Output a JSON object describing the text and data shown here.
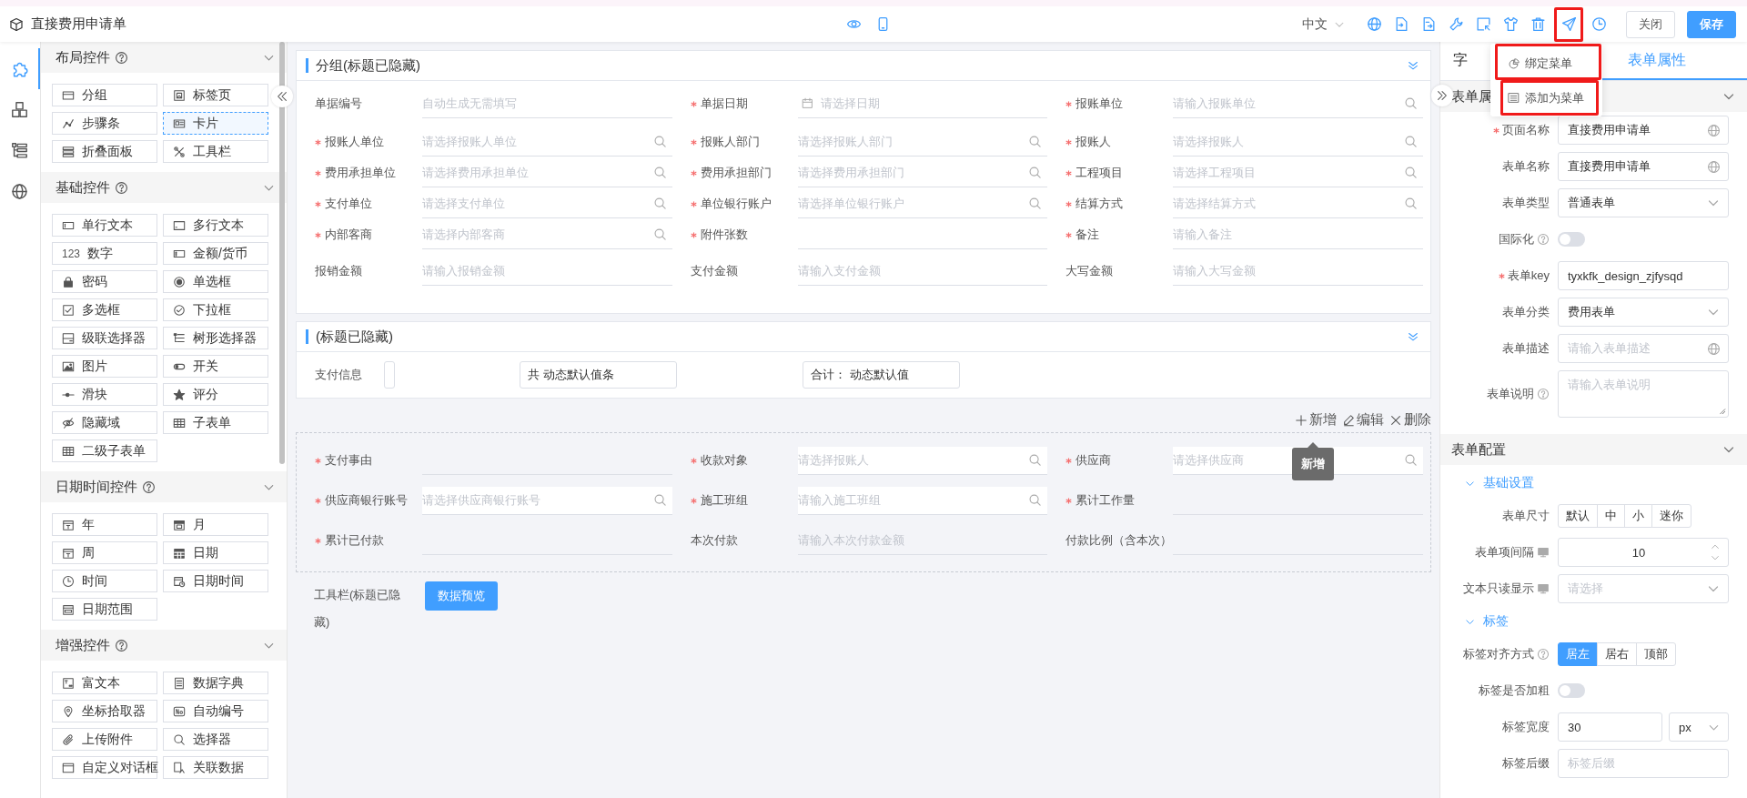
{
  "topbar": {
    "title": "直接费用申请单",
    "language": "中文",
    "buttons": [
      {
        "label": "关闭",
        "kind": "default"
      },
      {
        "label": "保存",
        "kind": "primary"
      }
    ]
  },
  "rail": [
    {
      "selected": true
    },
    {
      "selected": false
    },
    {
      "selected": false
    },
    {
      "selected": false
    }
  ],
  "palette": {
    "sections": [
      {
        "title": "布局控件",
        "items": [
          {
            "label": "分组",
            "selected": false
          },
          {
            "label": "标签页",
            "selected": false
          },
          {
            "label": "步骤条",
            "selected": false
          },
          {
            "label": "卡片",
            "selected": true
          },
          {
            "label": "折叠面板",
            "selected": false
          },
          {
            "label": "工具栏",
            "selected": false
          }
        ]
      },
      {
        "title": "基础控件",
        "items": [
          {
            "label": "单行文本",
            "selected": false
          },
          {
            "label": "多行文本",
            "selected": false
          },
          {
            "label": "数字",
            "glyph": "123",
            "selected": false
          },
          {
            "label": "金额/货币",
            "selected": false
          },
          {
            "label": "密码",
            "selected": false
          },
          {
            "label": "单选框",
            "selected": false
          },
          {
            "label": "多选框",
            "selected": false
          },
          {
            "label": "下拉框",
            "selected": false
          },
          {
            "label": "级联选择器",
            "selected": false
          },
          {
            "label": "树形选择器",
            "selected": false
          },
          {
            "label": "图片",
            "selected": false
          },
          {
            "label": "开关",
            "selected": false
          },
          {
            "label": "滑块",
            "selected": false
          },
          {
            "label": "评分",
            "selected": false
          },
          {
            "label": "隐藏域",
            "selected": false
          },
          {
            "label": "子表单",
            "selected": false
          },
          {
            "label": "二级子表单",
            "selected": false
          }
        ]
      },
      {
        "title": "日期时间控件",
        "items": [
          {
            "label": "年",
            "selected": false
          },
          {
            "label": "月",
            "selected": false
          },
          {
            "label": "周",
            "selected": false
          },
          {
            "label": "日期",
            "selected": false
          },
          {
            "label": "时间",
            "selected": false
          },
          {
            "label": "日期时间",
            "selected": false
          },
          {
            "label": "日期范围",
            "selected": false
          }
        ]
      },
      {
        "title": "增强控件",
        "items": [
          {
            "label": "富文本",
            "selected": false
          },
          {
            "label": "数据字典",
            "selected": false
          },
          {
            "label": "坐标拾取器",
            "selected": false
          },
          {
            "label": "自动编号",
            "selected": false
          },
          {
            "label": "上传附件",
            "selected": false
          },
          {
            "label": "选择器",
            "selected": false
          },
          {
            "label": "自定义对话框",
            "selected": false
          },
          {
            "label": "关联数据",
            "selected": false
          }
        ]
      }
    ]
  },
  "canvas": {
    "group": {
      "title": "分组(标题已隐藏)",
      "fields": [
        {
          "label": "单据编号",
          "required": false,
          "placeholder": "自动生成无需填写",
          "kind": "plain"
        },
        {
          "label": "单据日期",
          "required": true,
          "placeholder": "请选择日期",
          "kind": "date"
        },
        {
          "label": "报账单位",
          "required": true,
          "placeholder": "请输入报账单位",
          "kind": "search"
        },
        {
          "label": "报账人单位",
          "required": true,
          "placeholder": "请选择报账人单位",
          "kind": "search"
        },
        {
          "label": "报账人部门",
          "required": true,
          "placeholder": "请选择报账人部门",
          "kind": "search"
        },
        {
          "label": "报账人",
          "required": true,
          "placeholder": "请选择报账人",
          "kind": "search"
        },
        {
          "label": "费用承担单位",
          "required": true,
          "placeholder": "请选择费用承担单位",
          "kind": "search"
        },
        {
          "label": "费用承担部门",
          "required": true,
          "placeholder": "请选择费用承担部门",
          "kind": "search"
        },
        {
          "label": "工程项目",
          "required": true,
          "placeholder": "请选择工程项目",
          "kind": "search"
        },
        {
          "label": "支付单位",
          "required": true,
          "placeholder": "请选择支付单位",
          "kind": "search"
        },
        {
          "label": "单位银行账户",
          "required": true,
          "placeholder": "请选择单位银行账户",
          "kind": "search"
        },
        {
          "label": "结算方式",
          "required": true,
          "placeholder": "请选择结算方式",
          "kind": "search"
        },
        {
          "label": "内部客商",
          "required": true,
          "placeholder": "请选择内部客商",
          "kind": "search"
        },
        {
          "label": "附件张数",
          "required": true,
          "kind": "plain"
        },
        {
          "label": "备注",
          "required": true,
          "placeholder": "请输入备注",
          "kind": "plain"
        },
        {
          "label": "报销金额",
          "required": false,
          "placeholder": "请输入报销金额",
          "kind": "plain"
        },
        {
          "label": "支付金额",
          "required": false,
          "placeholder": "请输入支付金额",
          "kind": "plain"
        },
        {
          "label": "大写金额",
          "required": false,
          "placeholder": "请输入大写金额",
          "kind": "plain"
        }
      ]
    },
    "pay_group": {
      "title": "(标题已隐藏)",
      "label": "支付信息",
      "boxes": [
        "共 动态默认值条",
        "合计： 动态默认值"
      ]
    },
    "subform": {
      "actions": [
        "新增",
        "编辑",
        "删除"
      ],
      "tooltip": "新增",
      "fields": [
        {
          "label": "支付事由",
          "required": true,
          "kind": "plain"
        },
        {
          "label": "收款对象",
          "required": true,
          "placeholder": "请选择报账人",
          "kind": "search"
        },
        {
          "label": "供应商",
          "required": true,
          "placeholder": "请选择供应商",
          "kind": "search"
        },
        {
          "label": "供应商银行账号",
          "required": true,
          "placeholder": "请选择供应商银行账号",
          "kind": "search"
        },
        {
          "label": "施工班组",
          "required": true,
          "placeholder": "请输入施工班组",
          "kind": "search"
        },
        {
          "label": "累计工作量",
          "required": true,
          "kind": "plain"
        },
        {
          "label": "累计已付款",
          "required": true,
          "kind": "plain"
        },
        {
          "label": "本次付款",
          "required": false,
          "placeholder": "请输入本次付款金额",
          "kind": "plain"
        },
        {
          "label": "付款比例（含本次）",
          "required": false,
          "kind": "plain"
        }
      ]
    },
    "toolbar": {
      "label": "工具栏(标题已隐藏)",
      "button": "数据预览"
    }
  },
  "props": {
    "tabs": [
      {
        "label": "字",
        "selected": false
      },
      {
        "label": "表单属性",
        "selected": true
      }
    ],
    "sections": [
      {
        "title": "表单属",
        "rows": [
          {
            "kind": "i18n",
            "label": "页面名称",
            "required": true,
            "value": "直接费用申请单"
          },
          {
            "kind": "i18n",
            "label": "表单名称",
            "required": false,
            "value": "直接费用申请单"
          },
          {
            "kind": "select",
            "label": "表单类型",
            "value": "普通表单"
          },
          {
            "kind": "switch",
            "label": "国际化",
            "help": true,
            "on": false
          },
          {
            "kind": "text",
            "label": "表单key",
            "required": true,
            "value": "tyxkfk_design_zjfysqd"
          },
          {
            "kind": "select",
            "label": "表单分类",
            "value": "费用表单"
          },
          {
            "kind": "i18n",
            "label": "表单描述",
            "required": false,
            "placeholder": "请输入表单描述"
          },
          {
            "kind": "textarea",
            "label": "表单说明",
            "help": true,
            "placeholder": "请输入表单说明"
          }
        ]
      },
      {
        "title": "表单配置",
        "rows": [
          {
            "kind": "subhead",
            "label": "基础设置"
          },
          {
            "kind": "segmented",
            "label": "表单尺寸",
            "options": [
              {
                "label": "默认",
                "selected": false
              },
              {
                "label": "中",
                "selected": false
              },
              {
                "label": "小",
                "selected": false
              },
              {
                "label": "迷你",
                "selected": false
              }
            ]
          },
          {
            "kind": "number",
            "label": "表单项间隔",
            "device": true,
            "value": "10"
          },
          {
            "kind": "select",
            "label": "文本只读显示",
            "device": true,
            "placeholder": "请选择"
          },
          {
            "kind": "subhead",
            "label": "标签"
          },
          {
            "kind": "segmented",
            "label": "标签对齐方式",
            "help": true,
            "options": [
              {
                "label": "居左",
                "selected": true
              },
              {
                "label": "居右",
                "selected": false
              },
              {
                "label": "顶部",
                "selected": false
              }
            ]
          },
          {
            "kind": "switch",
            "label": "标签是否加粗",
            "on": false
          },
          {
            "kind": "unit",
            "label": "标签宽度",
            "value": "30",
            "unit": "px"
          },
          {
            "kind": "text",
            "label": "标签后缀",
            "placeholder": "标签后缀"
          }
        ]
      }
    ]
  },
  "menu": {
    "items": [
      "绑定菜单",
      "添加为菜单"
    ]
  }
}
